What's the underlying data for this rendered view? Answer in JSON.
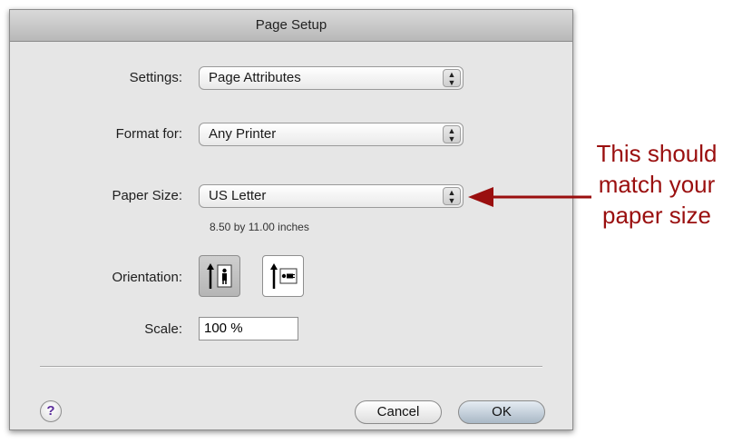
{
  "window": {
    "title": "Page Setup"
  },
  "settings": {
    "label": "Settings:",
    "value": "Page Attributes"
  },
  "format_for": {
    "label": "Format for:",
    "value": "Any Printer"
  },
  "paper_size": {
    "label": "Paper Size:",
    "value": "US Letter",
    "dimensions": "8.50 by 11.00 inches"
  },
  "orientation": {
    "label": "Orientation:",
    "options": [
      "portrait",
      "landscape"
    ],
    "selected": "portrait"
  },
  "scale": {
    "label": "Scale:",
    "value": "100 %"
  },
  "footer": {
    "help": "?",
    "cancel": "Cancel",
    "ok": "OK"
  },
  "annotation": {
    "lines": [
      "This should",
      "match your",
      "paper size"
    ],
    "color": "#9a0f0f"
  }
}
